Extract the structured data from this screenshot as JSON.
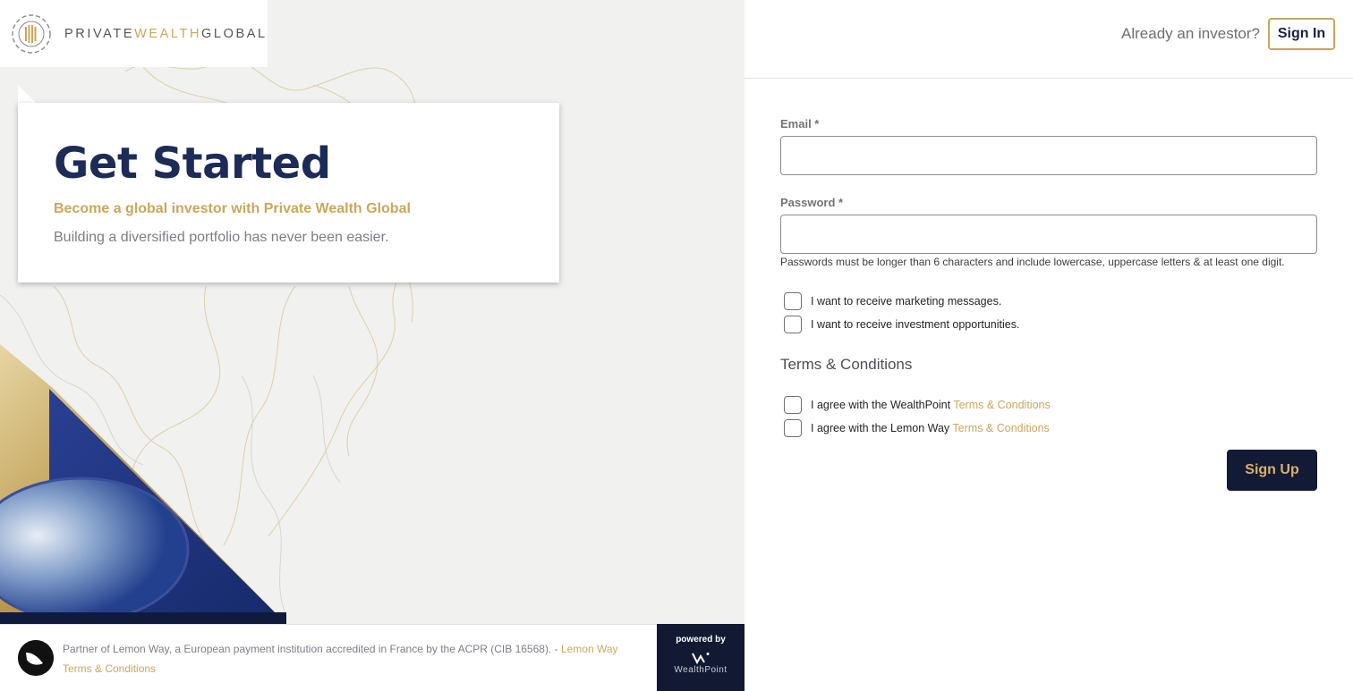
{
  "brand": {
    "logo_text_1": "PRIVATE",
    "logo_text_2": "WEALTH",
    "logo_text_3": "GLOBAL"
  },
  "hero": {
    "title": "Get Started",
    "subtitle": "Become a global investor with Private Wealth Global",
    "description": "Building a diversified portfolio has never been easier."
  },
  "footer": {
    "text": "Partner of Lemon Way, a European payment institution accredited in France by the ACPR (CIB 16568). - ",
    "link": "Lemon Way Terms & Conditions",
    "powered_by": "powered by",
    "powered_brand": "WealthPoint"
  },
  "header": {
    "already_investor": "Already an investor?",
    "sign_in": "Sign In"
  },
  "form": {
    "email_label": "Email *",
    "email_value": "",
    "password_label": "Password *",
    "password_value": "",
    "password_hint": "Passwords must be longer than 6 characters and include lowercase, uppercase letters & at least one digit.",
    "opt_marketing": "I want to receive marketing messages.",
    "opt_investment": "I want to receive investment opportunities.",
    "terms_title": "Terms & Conditions",
    "agree_wealthpoint_prefix": "I agree with the WealthPoint ",
    "agree_lemonway_prefix": "I agree with the Lemon Way ",
    "terms_link": "Terms & Conditions",
    "submit": "Sign Up"
  },
  "colors": {
    "navy": "#1c2b57",
    "gold": "#c9a75a",
    "button_dark": "#131a36"
  }
}
